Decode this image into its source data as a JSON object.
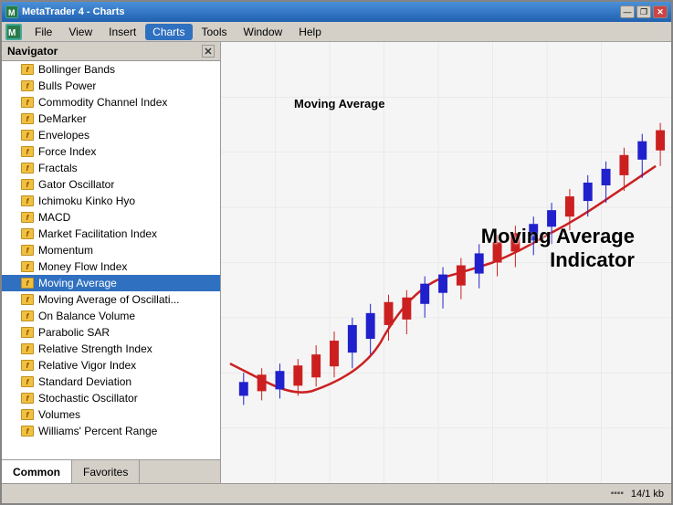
{
  "window": {
    "title": "MetaTrader 4 - Charts",
    "title_icon": "MT"
  },
  "title_bar": {
    "minimize_label": "—",
    "maximize_label": "❐",
    "close_label": "✕"
  },
  "menu": {
    "items": [
      {
        "id": "file",
        "label": "File"
      },
      {
        "id": "view",
        "label": "View"
      },
      {
        "id": "insert",
        "label": "Insert"
      },
      {
        "id": "charts",
        "label": "Charts"
      },
      {
        "id": "tools",
        "label": "Tools"
      },
      {
        "id": "window",
        "label": "Window"
      },
      {
        "id": "help",
        "label": "Help"
      }
    ]
  },
  "navigator": {
    "title": "Navigator",
    "close_label": "✕",
    "items": [
      {
        "id": "bollinger-bands",
        "label": "Bollinger Bands"
      },
      {
        "id": "bulls-power",
        "label": "Bulls Power"
      },
      {
        "id": "commodity-channel-index",
        "label": "Commodity Channel Index"
      },
      {
        "id": "demarker",
        "label": "DeMarker"
      },
      {
        "id": "envelopes",
        "label": "Envelopes"
      },
      {
        "id": "force-index",
        "label": "Force Index"
      },
      {
        "id": "fractals",
        "label": "Fractals"
      },
      {
        "id": "gator-oscillator",
        "label": "Gator Oscillator"
      },
      {
        "id": "ichimoku-kinko-hyo",
        "label": "Ichimoku Kinko Hyo"
      },
      {
        "id": "macd",
        "label": "MACD"
      },
      {
        "id": "market-facilitation-index",
        "label": "Market Facilitation Index"
      },
      {
        "id": "momentum",
        "label": "Momentum"
      },
      {
        "id": "money-flow-index",
        "label": "Money Flow Index"
      },
      {
        "id": "moving-average",
        "label": "Moving Average",
        "selected": true
      },
      {
        "id": "moving-average-oscillator",
        "label": "Moving Average of Oscillati..."
      },
      {
        "id": "on-balance-volume",
        "label": "On Balance Volume"
      },
      {
        "id": "parabolic-sar",
        "label": "Parabolic SAR"
      },
      {
        "id": "relative-strength-index",
        "label": "Relative Strength Index"
      },
      {
        "id": "relative-vigor-index",
        "label": "Relative Vigor Index"
      },
      {
        "id": "standard-deviation",
        "label": "Standard Deviation"
      },
      {
        "id": "stochastic-oscillator",
        "label": "Stochastic Oscillator"
      },
      {
        "id": "volumes",
        "label": "Volumes"
      },
      {
        "id": "williams-percent-range",
        "label": "Williams' Percent Range"
      }
    ],
    "tabs": [
      {
        "id": "common",
        "label": "Common",
        "active": true
      },
      {
        "id": "favorites",
        "label": "Favorites",
        "active": false
      }
    ]
  },
  "chart": {
    "label_moving_avg": "Moving Average",
    "label_indicator_line1": "Moving Average",
    "label_indicator_line2": "Indicator"
  },
  "status_bar": {
    "chart_icon": "▪▪▪▪",
    "size_info": "14/1 kb"
  }
}
